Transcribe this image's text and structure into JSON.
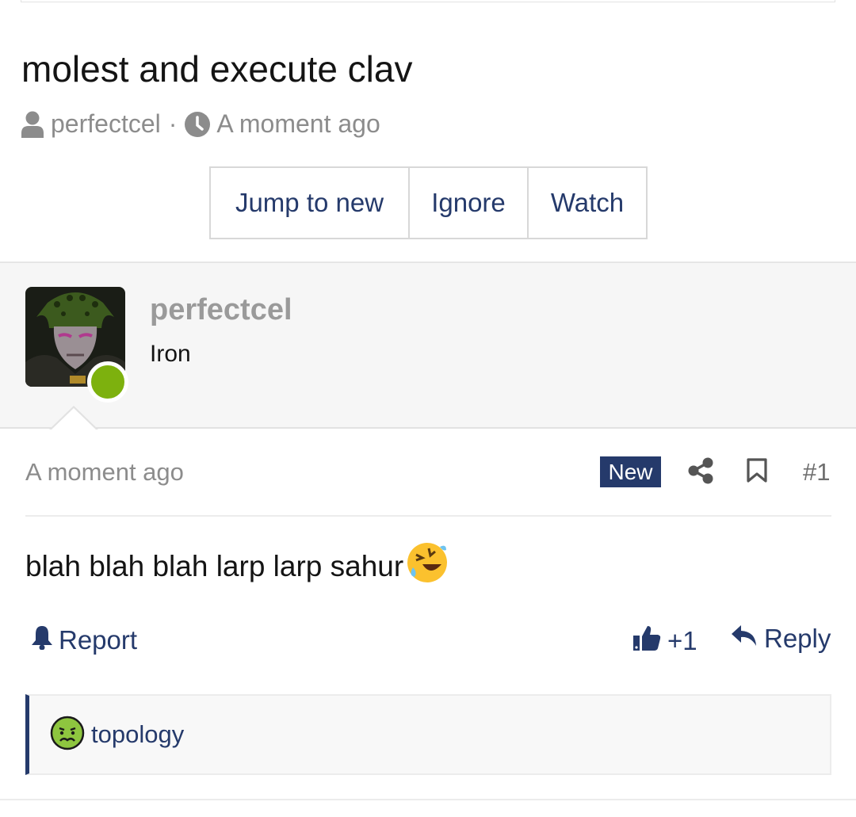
{
  "thread": {
    "title": "molest and execute clav",
    "author": "perfectcel",
    "separator": "·",
    "time": "A moment ago"
  },
  "actions": {
    "jump_to_new": "Jump to new",
    "ignore": "Ignore",
    "watch": "Watch"
  },
  "post": {
    "author_name": "perfectcel",
    "author_rank": "Iron",
    "online": true,
    "time": "A moment ago",
    "badge": "New",
    "number": "#1",
    "body": "blah blah blah larp larp sahur",
    "body_emoji": "rolling-on-floor-laughing-emoji",
    "report_label": "Report",
    "like_count": "+1",
    "reply_label": "Reply"
  },
  "reactions": {
    "emoji": "nauseated-face-emoji",
    "label": "topology"
  },
  "colors": {
    "accent": "#253a6b",
    "online": "#7db10e",
    "muted": "#8c8c8c",
    "panel": "#f6f6f6"
  }
}
